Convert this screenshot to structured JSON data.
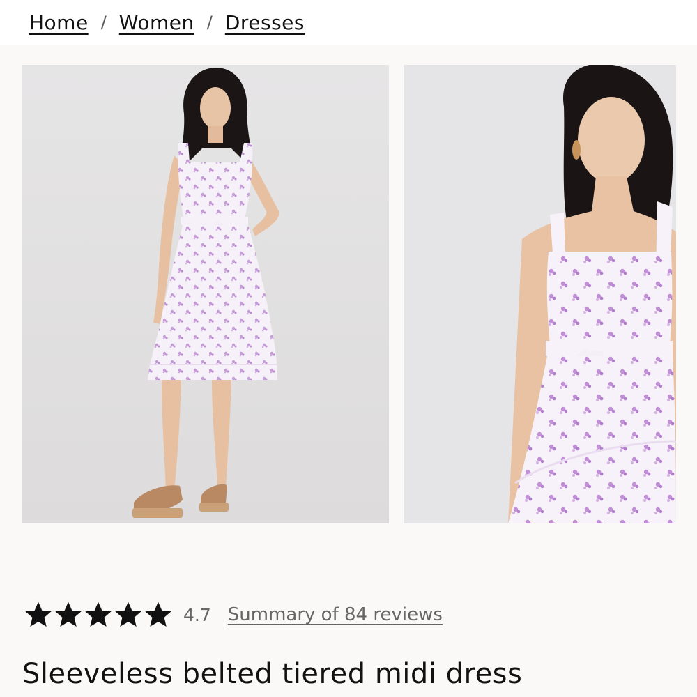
{
  "breadcrumb": {
    "items": [
      {
        "label": "Home"
      },
      {
        "label": "Women"
      },
      {
        "label": "Dresses"
      }
    ],
    "separator": "/"
  },
  "gallery": {
    "images": [
      {
        "alt": "Model wearing sleeveless belted tiered midi dress, full length front view"
      },
      {
        "alt": "Close-up of model wearing sleeveless belted tiered midi dress"
      }
    ]
  },
  "rating": {
    "stars": 5,
    "value": "4.7",
    "reviews_link": "Summary of 84 reviews"
  },
  "product": {
    "title": "Sleeveless belted tiered midi dress"
  },
  "colors": {
    "page_background": "#fbf9f7",
    "photo_background": "#e5e4e5",
    "dress_print": "#b98ccf",
    "text_primary": "#111111",
    "text_secondary": "#666666"
  }
}
